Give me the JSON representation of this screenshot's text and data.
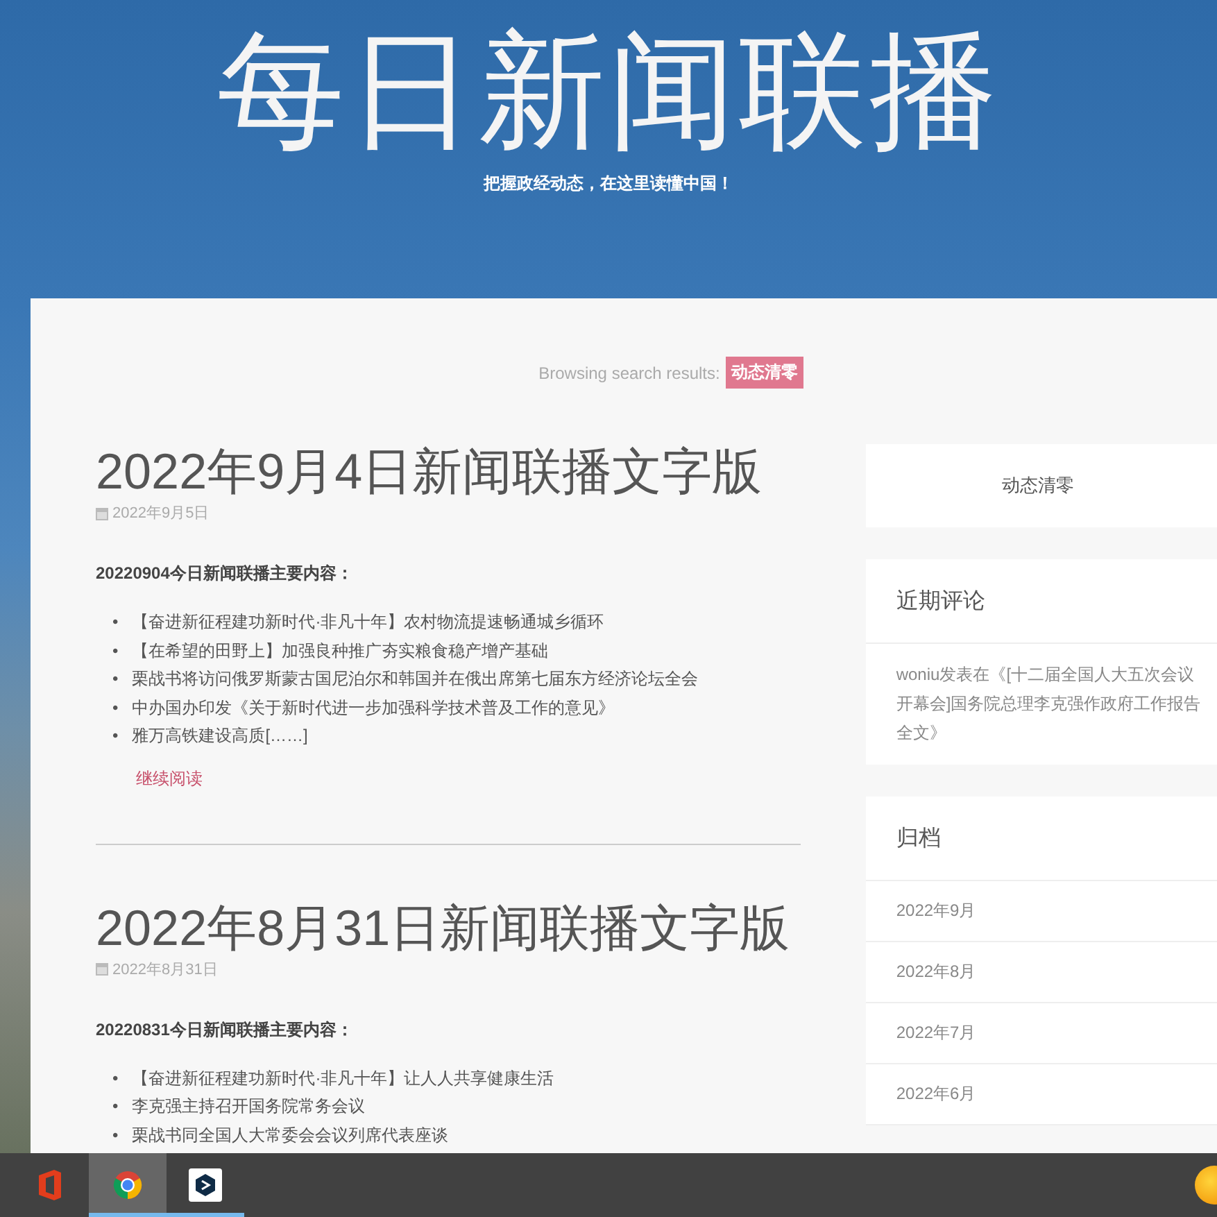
{
  "header": {
    "title": "每日新闻联播",
    "subtitle": "把握政经动态，在这里读懂中国！"
  },
  "search_results": {
    "label": "Browsing search results:",
    "term": "动态清零"
  },
  "posts": [
    {
      "title": "2022年9月4日新闻联播文字版",
      "date": "2022年9月5日",
      "intro": "20220904今日新闻联播主要内容：",
      "items": [
        "【奋进新征程建功新时代·非凡十年】农村物流提速畅通城乡循环",
        "【在希望的田野上】加强良种推广夯实粮食稳产增产基础",
        "栗战书将访问俄罗斯蒙古国尼泊尔和韩国并在俄出席第七届东方经济论坛全会",
        "中办国办印发《关于新时代进一步加强科学技术普及工作的意见》",
        "雅万高铁建设高质[……]"
      ],
      "read_more": "继续阅读",
      "bullet": "•"
    },
    {
      "title": "2022年8月31日新闻联播文字版",
      "date": "2022年8月31日",
      "intro": "20220831今日新闻联播主要内容：",
      "items": [
        "【奋进新征程建功新时代·非凡十年】让人人共享健康生活",
        "李克强主持召开国务院常务会议",
        "栗战书同全国人大常委会会议列席代表座谈"
      ],
      "bullet": "•"
    }
  ],
  "sidebar": {
    "tag_widget": {
      "text": "动态清零"
    },
    "recent_comments": {
      "title": "近期评论",
      "comments": [
        {
          "author": "woniu",
          "verb": "发表在",
          "post": "《[十二届全国人大五次会议开幕会]国务院总理李克强作政府工作报告全文》"
        }
      ]
    },
    "archives": {
      "title": "归档",
      "items": [
        "2022年9月",
        "2022年8月",
        "2022年7月",
        "2022年6月"
      ]
    }
  },
  "taskbar": {
    "apps": [
      {
        "kind": "office",
        "selected": false,
        "running": false
      },
      {
        "kind": "chrome",
        "selected": true,
        "running": true
      },
      {
        "kind": "dark-app",
        "selected": false,
        "running": true
      }
    ]
  }
}
